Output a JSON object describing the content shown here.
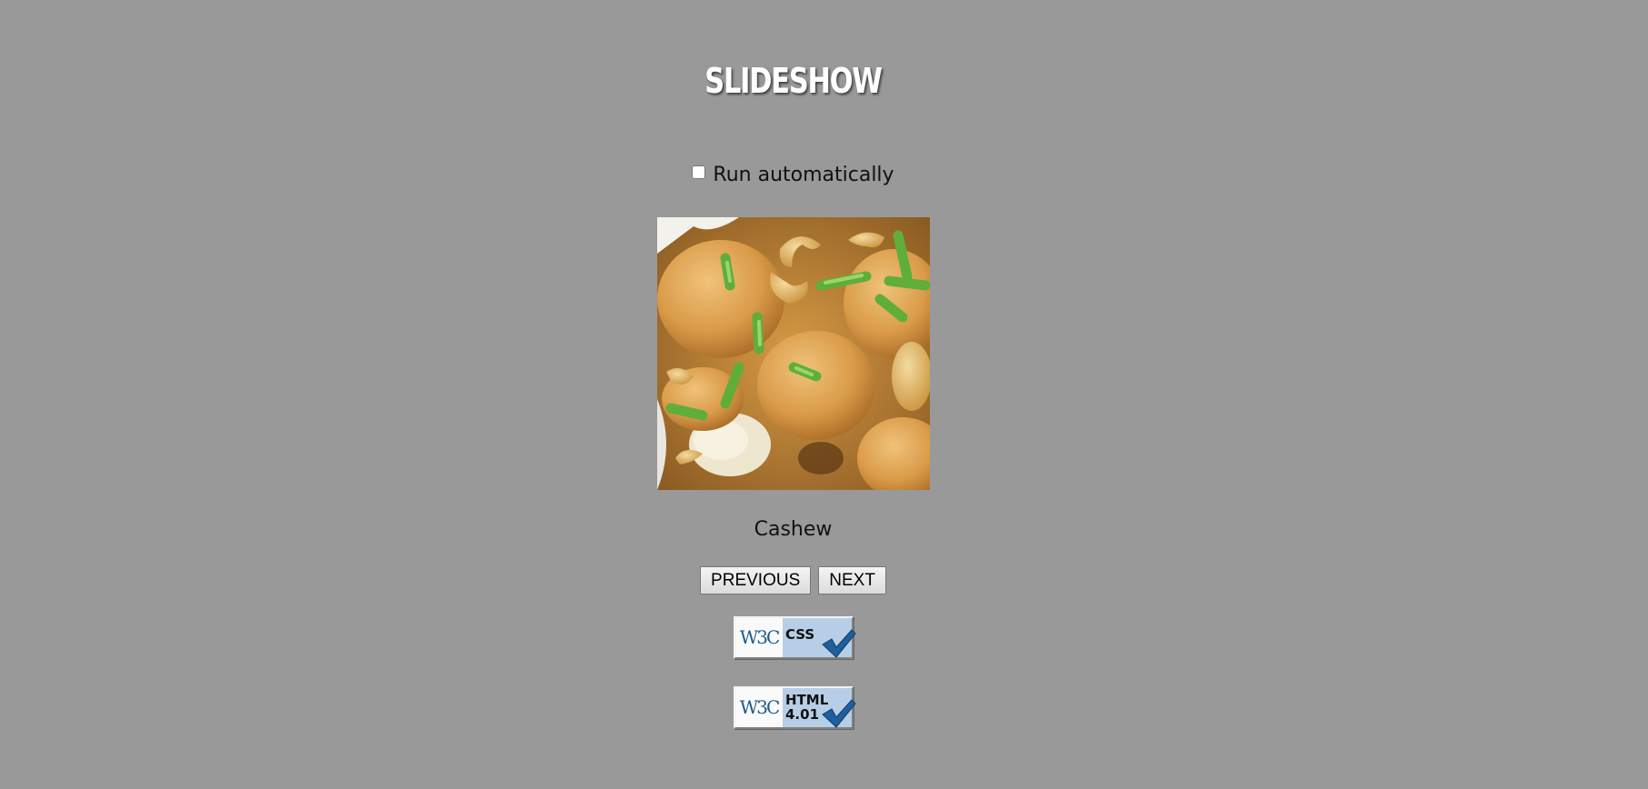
{
  "header": {
    "title": "SLIDESHOW"
  },
  "controls": {
    "run_automatically_label": "Run automatically",
    "run_automatically_checked": false
  },
  "slide": {
    "caption": "Cashew",
    "image_description_icon": "cashew-chicken-photo"
  },
  "nav": {
    "previous_label": "PREVIOUS",
    "next_label": "NEXT"
  },
  "badges": {
    "css": {
      "w3c_text": "W3C",
      "label": "CSS"
    },
    "html": {
      "w3c_text": "W3C",
      "label_line1": "HTML",
      "label_line2": "4.01"
    }
  },
  "colors": {
    "background": "#999999",
    "title": "#ffffff",
    "badge_blue": "#b7cfe6",
    "check": "#1f5f9e"
  }
}
